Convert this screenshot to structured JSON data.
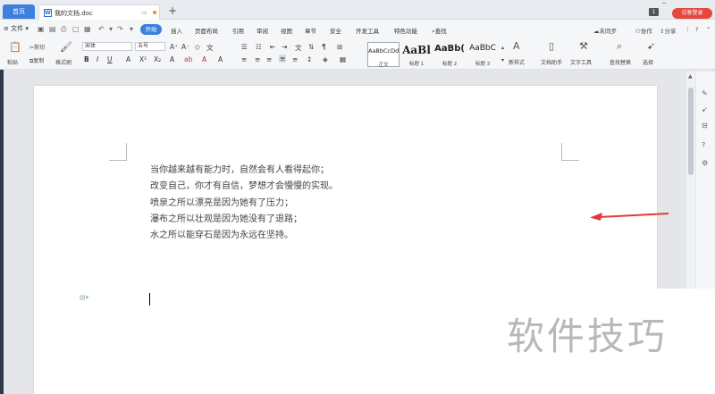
{
  "tabs": {
    "home": "首页",
    "doc": "我的文档.doc",
    "new_tab": "+"
  },
  "titlebar": {
    "badge": "1",
    "login": "访客登录"
  },
  "menubar": {
    "file": "文件",
    "start": "开始",
    "items": [
      "插入",
      "页面布局",
      "引用",
      "审阅",
      "视图",
      "章节",
      "安全",
      "开发工具",
      "特色功能"
    ],
    "search": "查找",
    "right": [
      "未同步",
      "协作",
      "分享"
    ]
  },
  "ribbon": {
    "cut": "剪切",
    "copy": "复制",
    "paste": "粘贴",
    "format_painter": "格式刷",
    "font_name": "宋体",
    "font_size": "五号",
    "styles": [
      {
        "preview": "AaBbCcDd",
        "label": "正文"
      },
      {
        "preview": "AaBl",
        "label": "标题 1"
      },
      {
        "preview": "AaBb(",
        "label": "标题 2"
      },
      {
        "preview": "AaBbC",
        "label": "标题 3"
      }
    ],
    "new_style": "新样式",
    "doc_helper": "文档助手",
    "text_tools": "文字工具",
    "find_replace": "查找替换",
    "select": "选择"
  },
  "document": {
    "lines": [
      "当你越来越有能力时，自然会有人看得起你；",
      "改变自己，你才有自信，梦想才会慢慢的实现。",
      "喷泉之所以漂亮是因为她有了压力；",
      "瀑布之所以壮观是因为她没有了退路；",
      "水之所以能穿石是因为永远在坚持。"
    ]
  },
  "watermark": "软件技巧",
  "colors": {
    "accent": "#3c7fe0",
    "arrow": "#e53935",
    "login": "#e8473e"
  }
}
